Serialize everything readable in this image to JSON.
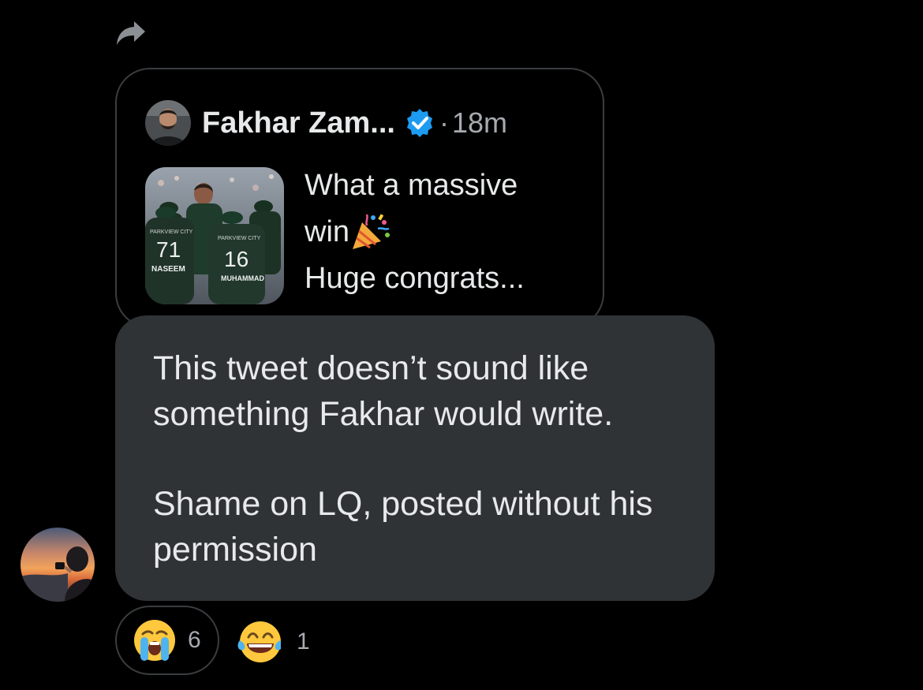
{
  "share": {
    "icon": "share-arrow-icon"
  },
  "quoted_tweet": {
    "author_name": "Fakhar Zam...",
    "separator": "·",
    "time": "18m",
    "text_lines": [
      "What a massive",
      "win",
      "Huge congrats..."
    ],
    "media_texts": {
      "jersey_brand_1": "PARKVIEW CITY",
      "jersey_number_1": "71",
      "jersey_name_1": "NASEEM",
      "jersey_brand_2": "PARKVIEW CITY",
      "jersey_number_2": "16",
      "jersey_name_2": "MUHAMMAD"
    },
    "verified_color": "#1d9bf0"
  },
  "message": {
    "paragraphs": [
      "This tweet doesn’t sound like something Fakhar would write.",
      "Shame on LQ, posted without his permission"
    ],
    "bubble_color": "#2f3336"
  },
  "reactions": [
    {
      "icon": "loudly-crying-face-icon",
      "count": "6",
      "selected": true
    },
    {
      "icon": "face-with-tears-of-joy-icon",
      "count": "1",
      "selected": false
    }
  ]
}
